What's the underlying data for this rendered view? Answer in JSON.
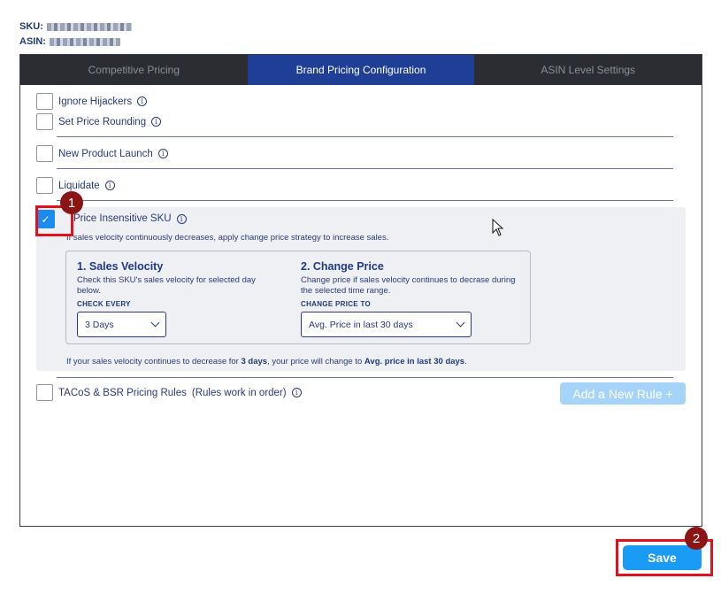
{
  "meta": {
    "sku_label": "SKU:",
    "asin_label": "ASIN:"
  },
  "tabs": [
    {
      "label": "Competitive Pricing",
      "active": false
    },
    {
      "label": "Brand Pricing Configuration",
      "active": true
    },
    {
      "label": "ASIN Level Settings",
      "active": false
    }
  ],
  "options": {
    "ignore_hijackers": "Ignore Hijackers",
    "set_price_rounding": "Set Price Rounding",
    "new_product_launch": "New Product Launch",
    "liquidate": "Liquidate",
    "price_insensitive": "Price Insensitive SKU",
    "tacos_bsr": "TACoS & BSR Pricing Rules",
    "tacos_note": "(Rules work in order)"
  },
  "price_insensitive": {
    "checked": true,
    "description": "If sales velocity continuously decreases, apply change price strategy to increase sales.",
    "sales_velocity": {
      "title": "1. Sales Velocity",
      "desc": "Check this SKU's sales velocity for selected day below.",
      "label": "CHECK EVERY",
      "value": "3 Days"
    },
    "change_price": {
      "title": "2. Change Price",
      "desc": "Change price if sales velocity continues to decrase during the selected time range.",
      "label": "CHANGE PRICE TO",
      "value": "Avg. Price in last 30 days"
    },
    "summary_pre": "If your sales velocity continues to decrease for ",
    "summary_days": "3 days",
    "summary_mid": ", your price will change to ",
    "summary_price": "Avg. price in last 30 days",
    "summary_end": "."
  },
  "buttons": {
    "add_rule": "Add a New Rule +",
    "save": "Save"
  },
  "annotations": {
    "badge1": "1",
    "badge2": "2"
  },
  "colors": {
    "accent": "#1a9bf5",
    "tab_active": "#1f3f96",
    "highlight": "#e0121f",
    "badge": "#8b1414"
  }
}
